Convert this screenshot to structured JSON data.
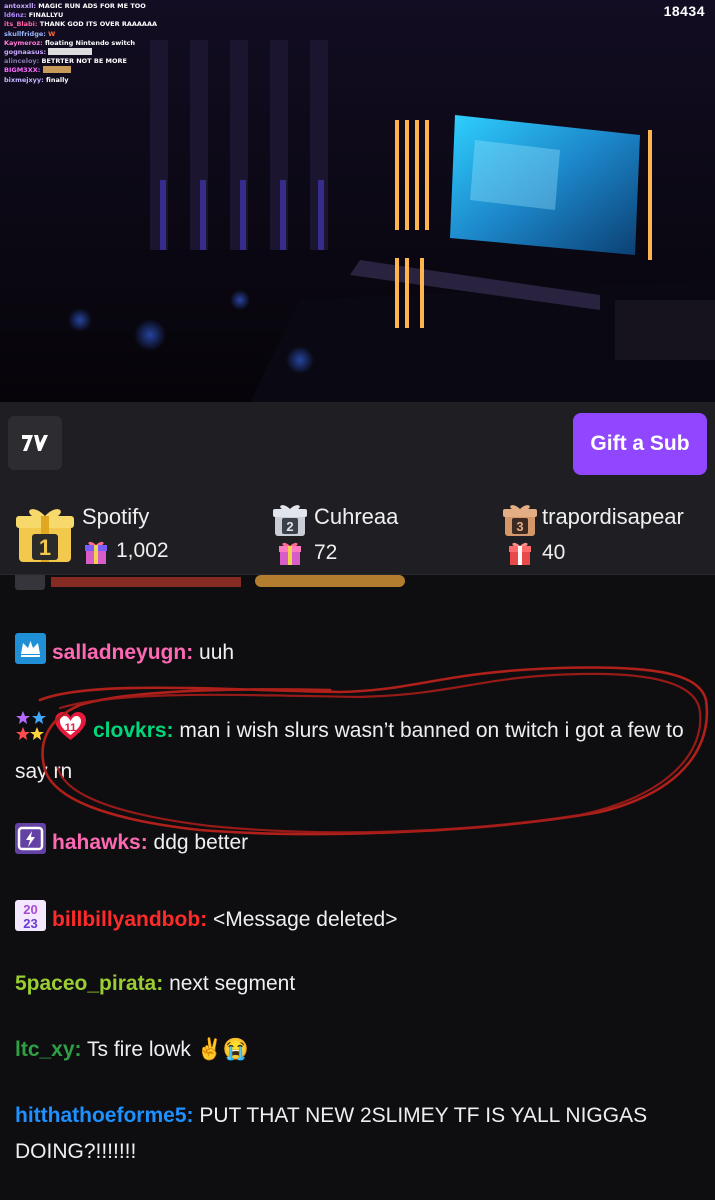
{
  "stream": {
    "viewer_count": "18434",
    "overlay_chat": [
      {
        "user": "antoxxll:",
        "text": "MAGIC RUN ADS FOR ME TOO",
        "color": "#c9a8ff"
      },
      {
        "user": "ld6nz:",
        "text": "FINALLYU",
        "color": "#b18cff"
      },
      {
        "user": "its_Blabi:",
        "text": "THANK GOD ITS OVER RAAAAAA",
        "color": "#ff63a6"
      },
      {
        "user": "skullfridge:",
        "text": "W",
        "color": "#9bb7ff"
      },
      {
        "user": "Kaymeroz:",
        "text": "floating Nintendo switch",
        "color": "#ff7bd5"
      },
      {
        "user": "gognaasus:",
        "text": "",
        "color": "#c9a8ff"
      },
      {
        "user": "alinceloy:",
        "text": "BETRTER NOT BE MORE",
        "color": "#8877aa"
      },
      {
        "user": "BIGM3XX:",
        "text": "",
        "color": "#ff6bff"
      },
      {
        "user": "bixmejxyy:",
        "text": "finally",
        "color": "#c3b6ff"
      }
    ]
  },
  "toolbar": {
    "gift_button_label": "Gift a Sub",
    "extension_logo": "7tv-logo"
  },
  "leaderboard": {
    "entries": [
      {
        "rank": "1",
        "name": "Spotify",
        "count": "1,002"
      },
      {
        "rank": "2",
        "name": "Cuhreaa",
        "count": "72"
      },
      {
        "rank": "3",
        "name": "trapordisapear",
        "count": "40"
      }
    ]
  },
  "chat": {
    "messages": [
      {
        "user": "salladneyugn:",
        "text": "uuh",
        "color": "#ff69b4"
      },
      {
        "user": "clovkrs:",
        "text": "man i wish slurs wasn’t banned on twitch i got a few to say rn",
        "color": "#00d77a"
      },
      {
        "user": "hahawks:",
        "text": "ddg better",
        "color": "#ff69b4"
      },
      {
        "user": "billbillyandbob:",
        "text": "<Message deleted>",
        "color": "#ff2a2a"
      },
      {
        "user": "5paceo_pirata:",
        "text": "next segment",
        "color": "#9acd32"
      },
      {
        "user": "ltc_xy:",
        "text": "Ts fire lowk ✌️😭",
        "color": "#2ea043"
      },
      {
        "user": "hitthathoeforme5:",
        "text": "PUT THAT NEW 2SLIMEY TF IS YALL NIGGAS DOING?!!!!!!!",
        "color": "#1e90ff"
      }
    ]
  },
  "colors": {
    "accent": "#9147ff",
    "annotation": "#c0201b"
  }
}
